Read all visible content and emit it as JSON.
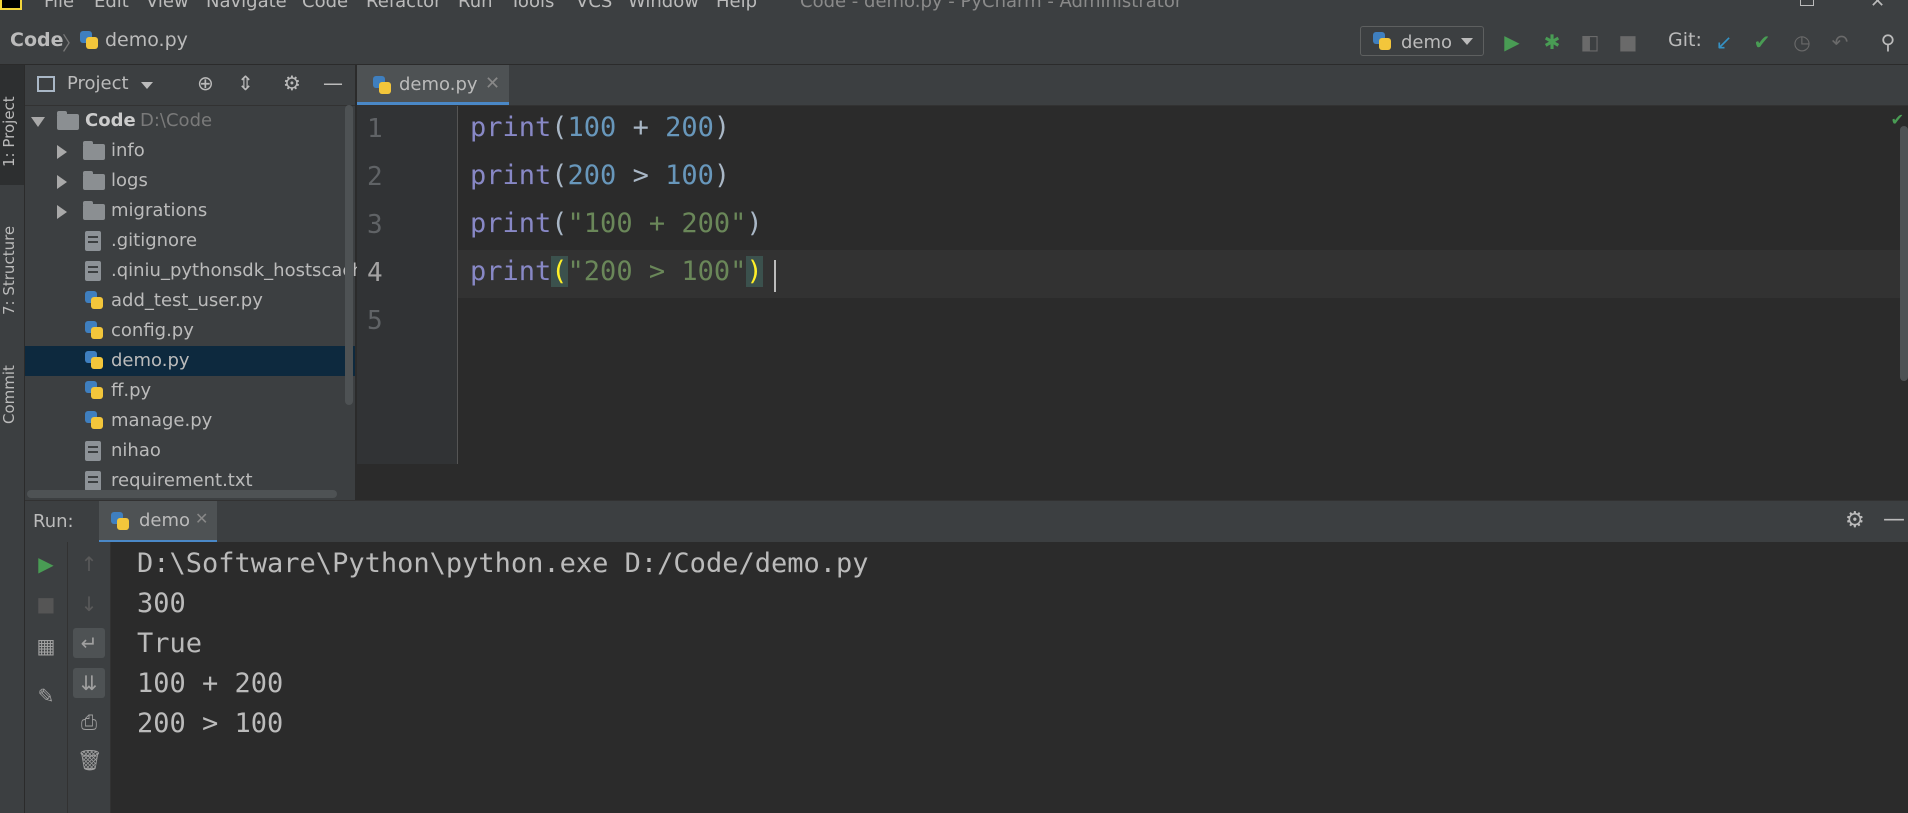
{
  "menu": {
    "items": [
      "File",
      "Edit",
      "View",
      "Navigate",
      "Code",
      "Refactor",
      "Run",
      "Tools",
      "VCS",
      "Window",
      "Help"
    ],
    "title": "Code - demo.py - PyCharm - Administrator"
  },
  "navbar": {
    "crumb_project": "Code",
    "crumb_file": "demo.py",
    "run_config": "demo",
    "git_label": "Git:"
  },
  "sidebar_tabs": {
    "project": "1: Project",
    "structure": "7: Structure",
    "commit": "Commit"
  },
  "project": {
    "header": "Project",
    "root": {
      "name": "Code",
      "path": "D:\\Code"
    },
    "items": [
      {
        "name": "info",
        "type": "folder"
      },
      {
        "name": "logs",
        "type": "folder"
      },
      {
        "name": "migrations",
        "type": "folder"
      },
      {
        "name": ".gitignore",
        "type": "file"
      },
      {
        "name": ".qiniu_pythonsdk_hostscache",
        "type": "file"
      },
      {
        "name": "add_test_user.py",
        "type": "py"
      },
      {
        "name": "config.py",
        "type": "py"
      },
      {
        "name": "demo.py",
        "type": "py",
        "selected": true
      },
      {
        "name": "ff.py",
        "type": "py"
      },
      {
        "name": "manage.py",
        "type": "py"
      },
      {
        "name": "nihao",
        "type": "file"
      },
      {
        "name": "requirement.txt",
        "type": "file"
      }
    ]
  },
  "editor": {
    "tab": "demo.py",
    "line_numbers": [
      "1",
      "2",
      "3",
      "4",
      "5"
    ],
    "lines": [
      {
        "fn": "print",
        "args": "100 + 200"
      },
      {
        "fn": "print",
        "args": "200 > 100"
      },
      {
        "fn": "print",
        "args": "\"100 + 200\""
      },
      {
        "fn": "print",
        "args": "\"200 > 100\""
      }
    ],
    "current_line": "4"
  },
  "run": {
    "label": "Run:",
    "tab": "demo",
    "output": [
      "D:\\Software\\Python\\python.exe D:/Code/demo.py",
      "300",
      "True",
      "100 + 200",
      "200 > 100"
    ]
  },
  "icons": {
    "run": "play-icon",
    "debug": "bug-icon",
    "coverage": "coverage-icon",
    "stop": "stop-icon",
    "git_update": "arrow-down-left-icon",
    "git_commit": "check-icon",
    "git_history": "clock-icon",
    "git_rollback": "undo-icon",
    "search": "search-icon"
  },
  "colors": {
    "accent": "#4a88c7",
    "keyword": "#8888c6",
    "number": "#6897bb",
    "string": "#6a8759",
    "green": "#499c54"
  }
}
